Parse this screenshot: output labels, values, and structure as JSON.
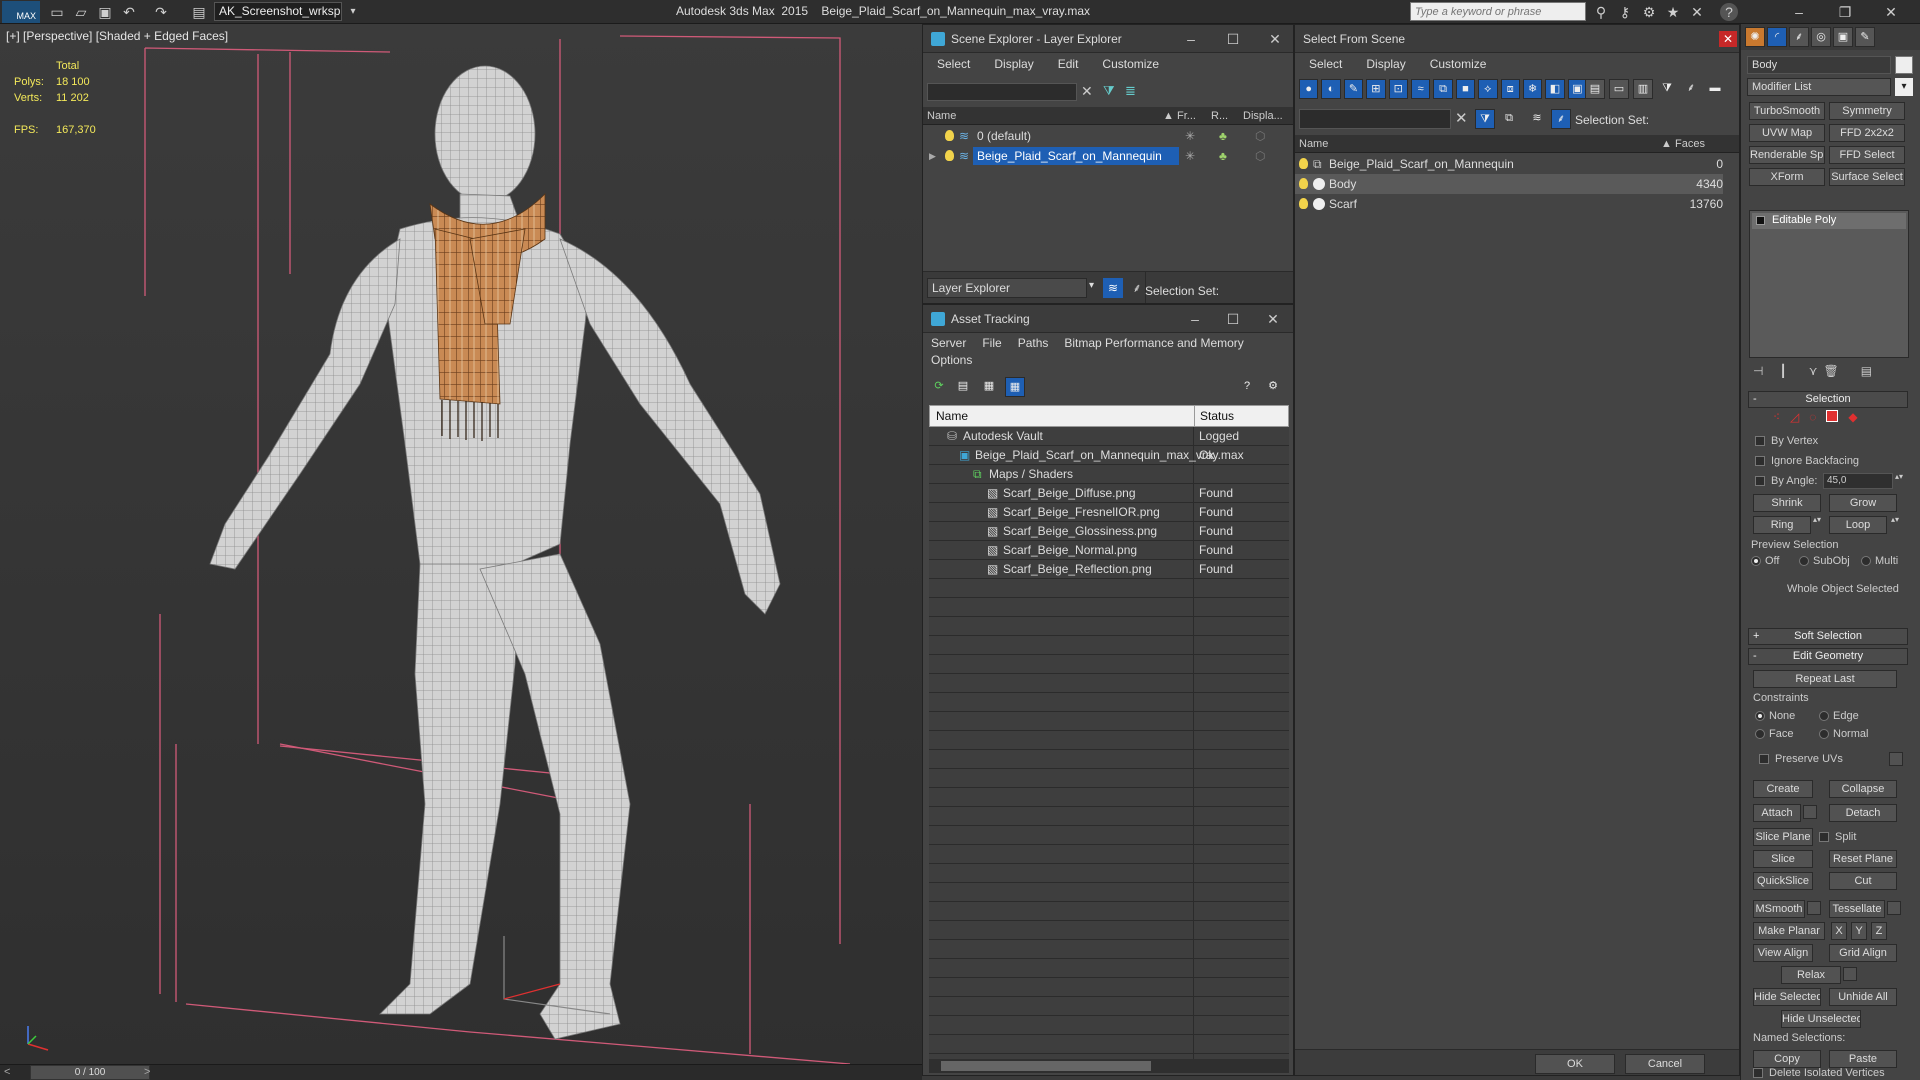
{
  "app": {
    "title": "Autodesk 3ds Max  2015    Beige_Plaid_Scarf_on_Mannequin_max_vray.max",
    "logo": "MAX",
    "workspace": "AK_Screenshot_wrksp",
    "search_placeholder": "Type a keyword or phrase"
  },
  "viewport": {
    "label": "[+] [Perspective] [Shaded + Edged Faces]",
    "total": "Total",
    "polys_label": "Polys:",
    "polys": "18 100",
    "verts_label": "Verts:",
    "verts": "11 202",
    "fps_label": "FPS:",
    "fps": "167,370"
  },
  "timeline": {
    "frame": "0 / 100"
  },
  "scene_explorer": {
    "title": "Scene Explorer - Layer Explorer",
    "menu": [
      "Select",
      "Display",
      "Edit",
      "Customize"
    ],
    "cols": {
      "name": "Name",
      "fr": "Fr...",
      "r": "R...",
      "disp": "Displa..."
    },
    "layers": [
      "0 (default)",
      "Beige_Plaid_Scarf_on_Mannequin"
    ],
    "footer": "Layer Explorer",
    "selset": "Selection Set:"
  },
  "asset_tracking": {
    "title": "Asset Tracking",
    "menu1": [
      "Server",
      "File",
      "Paths",
      "Bitmap Performance and Memory"
    ],
    "menu2": "Options",
    "cols": {
      "name": "Name",
      "status": "Status"
    },
    "rows": [
      {
        "name": "Autodesk Vault",
        "status": "Logged"
      },
      {
        "name": "Beige_Plaid_Scarf_on_Mannequin_max_vray.max",
        "status": "Ok"
      },
      {
        "name": "Maps / Shaders",
        "status": ""
      },
      {
        "name": "Scarf_Beige_Diffuse.png",
        "status": "Found"
      },
      {
        "name": "Scarf_Beige_FresnelIOR.png",
        "status": "Found"
      },
      {
        "name": "Scarf_Beige_Glossiness.png",
        "status": "Found"
      },
      {
        "name": "Scarf_Beige_Normal.png",
        "status": "Found"
      },
      {
        "name": "Scarf_Beige_Reflection.png",
        "status": "Found"
      }
    ]
  },
  "select_from_scene": {
    "title": "Select From Scene",
    "menu": [
      "Select",
      "Display",
      "Customize"
    ],
    "selset": "Selection Set:",
    "cols": {
      "name": "Name",
      "faces": "Faces"
    },
    "rows": [
      {
        "name": "Beige_Plaid_Scarf_on_Mannequin",
        "faces": "0"
      },
      {
        "name": "Body",
        "faces": "4340"
      },
      {
        "name": "Scarf",
        "faces": "13760"
      }
    ],
    "ok": "OK",
    "cancel": "Cancel"
  },
  "command_panel": {
    "object_name": "Body",
    "modifier_list": "Modifier List",
    "mod_buttons": [
      "TurboSmooth",
      "Symmetry",
      "UVW Map",
      "FFD 2x2x2",
      "Renderable Spline",
      "FFD Select",
      "XForm",
      "Surface Select"
    ],
    "stack_item": "Editable Poly",
    "selection": {
      "title": "Selection",
      "by_vertex": "By Vertex",
      "ignore_backfacing": "Ignore Backfacing",
      "by_angle": "By Angle:",
      "angle": "45,0",
      "shrink": "Shrink",
      "grow": "Grow",
      "ring": "Ring",
      "loop": "Loop",
      "preview": "Preview Selection",
      "off": "Off",
      "subobj": "SubObj",
      "multi": "Multi",
      "whole": "Whole Object Selected"
    },
    "soft_selection": "Soft Selection",
    "edit_geometry": {
      "title": "Edit Geometry",
      "repeat_last": "Repeat Last",
      "constraints": "Constraints",
      "none": "None",
      "edge": "Edge",
      "face": "Face",
      "normal": "Normal",
      "preserve_uvs": "Preserve UVs",
      "create": "Create",
      "collapse": "Collapse",
      "attach": "Attach",
      "detach": "Detach",
      "slice_plane": "Slice Plane",
      "split": "Split",
      "slice": "Slice",
      "reset_plane": "Reset Plane",
      "quickslice": "QuickSlice",
      "cut": "Cut",
      "msmooth": "MSmooth",
      "tessellate": "Tessellate",
      "make_planar": "Make Planar",
      "x": "X",
      "y": "Y",
      "z": "Z",
      "view_align": "View Align",
      "grid_align": "Grid Align",
      "relax": "Relax",
      "hide_selected": "Hide Selected",
      "unhide_all": "Unhide All",
      "hide_unselected": "Hide Unselected",
      "named_selections": "Named Selections:",
      "copy": "Copy",
      "paste": "Paste",
      "delete_isolated": "Delete Isolated Vertices"
    }
  },
  "colors": {
    "selection_blue": "#1e5fb4",
    "stat_yellow": "#f3e85a",
    "bbox_pink": "#d05a78",
    "gizmo_red": "#e03030"
  }
}
